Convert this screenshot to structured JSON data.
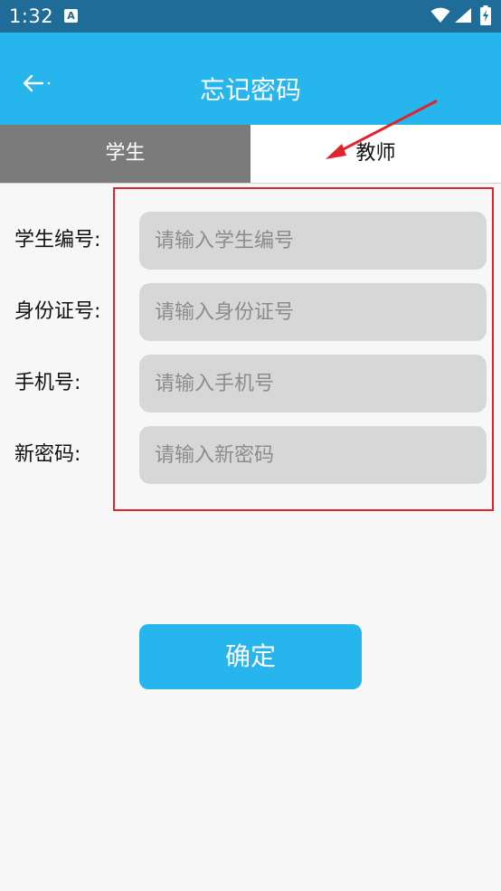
{
  "status_bar": {
    "time": "1:32",
    "notification_icon_letter": "A"
  },
  "header": {
    "title": "忘记密码",
    "back_icon": "arrow-left-icon"
  },
  "tabs": [
    {
      "label": "学生",
      "selected": true
    },
    {
      "label": "教师",
      "selected": false
    }
  ],
  "form": {
    "fields": [
      {
        "label": "学生编号:",
        "placeholder": "请输入学生编号",
        "value": ""
      },
      {
        "label": "身份证号:",
        "placeholder": "请输入身份证号",
        "value": ""
      },
      {
        "label": "手机号:",
        "placeholder": "请输入手机号",
        "value": ""
      },
      {
        "label": "新密码:",
        "placeholder": "请输入新密码",
        "value": ""
      }
    ]
  },
  "confirm_label": "确定",
  "colors": {
    "status_bar": "#1e6c97",
    "primary": "#27b5ed",
    "tab_selected_bg": "#7b7b7b",
    "input_bg": "#d7d7d7",
    "annotation_red": "#e1242c"
  }
}
